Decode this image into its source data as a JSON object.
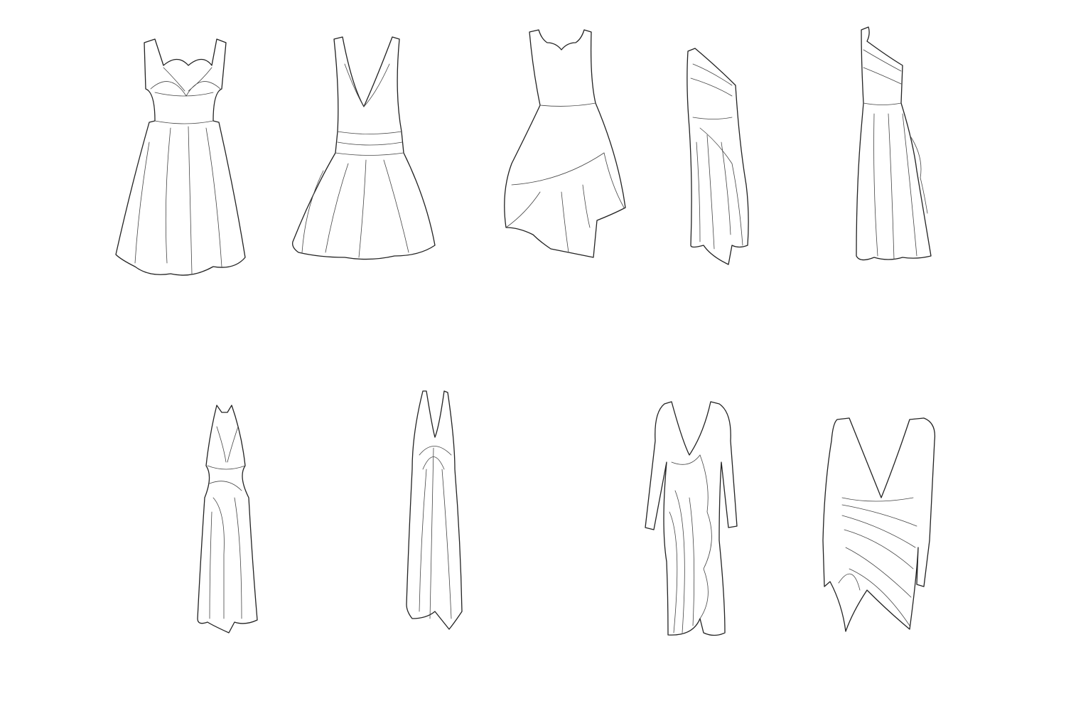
{
  "canvas": {
    "background": "#ffffff",
    "line_color": "#222222"
  },
  "sketches": [
    {
      "id": "sweetheart-flared-dress"
    },
    {
      "id": "v-neck-full-skirt-dress"
    },
    {
      "id": "scalloped-asymmetric-dress"
    },
    {
      "id": "one-shoulder-draped-gown"
    },
    {
      "id": "one-shoulder-ruffle-gown"
    },
    {
      "id": "halter-ruched-gown"
    },
    {
      "id": "plunge-halter-gown"
    },
    {
      "id": "long-sleeve-ruffle-dress"
    },
    {
      "id": "long-sleeve-v-asymmetric-dress"
    }
  ]
}
